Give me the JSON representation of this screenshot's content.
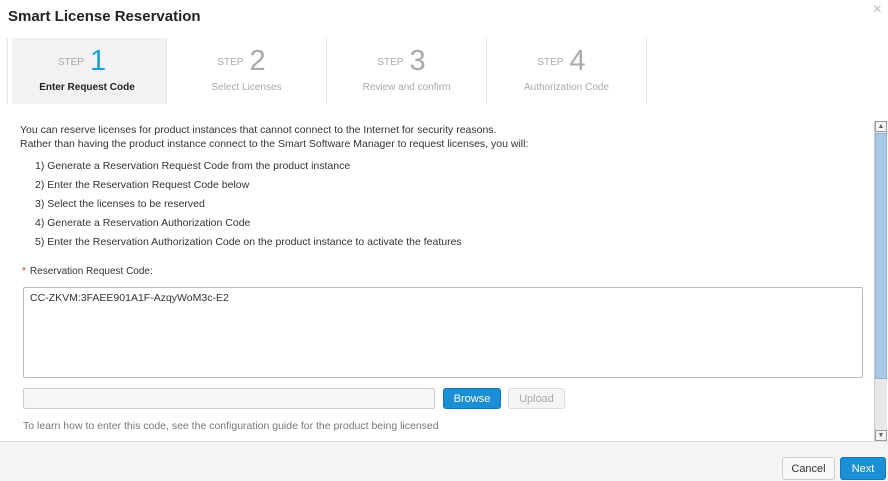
{
  "dialog": {
    "title": "Smart License Reservation",
    "close_icon": "×"
  },
  "steps": [
    {
      "label": "STEP",
      "number": "1",
      "name": "Enter Request Code"
    },
    {
      "label": "STEP",
      "number": "2",
      "name": "Select Licenses"
    },
    {
      "label": "STEP",
      "number": "3",
      "name": "Review and confirm"
    },
    {
      "label": "STEP",
      "number": "4",
      "name": "Authorization Code"
    }
  ],
  "content": {
    "intro_1": "You can reserve licenses for product instances that cannot connect to the Internet for security reasons.",
    "intro_2": "Rather than having the product instance connect to the Smart Software Manager to request licenses, you will:",
    "list": [
      "1) Generate a Reservation Request Code from the product instance",
      "2) Enter the Reservation Request Code below",
      "3) Select the licenses to be reserved",
      "4) Generate a Reservation Authorization Code",
      "5) Enter the Reservation Authorization Code on the product instance to activate the features"
    ],
    "required_mark": "*",
    "field_label": "Reservation Request Code:",
    "field_value": "CC-ZKVM:3FAEE901A1F-AzqyWoM3c-E2",
    "browse": "Browse",
    "upload": "Upload",
    "hint": "To learn how to enter this code, see the configuration guide for the product being licensed"
  },
  "footer": {
    "cancel": "Cancel",
    "next": "Next"
  }
}
